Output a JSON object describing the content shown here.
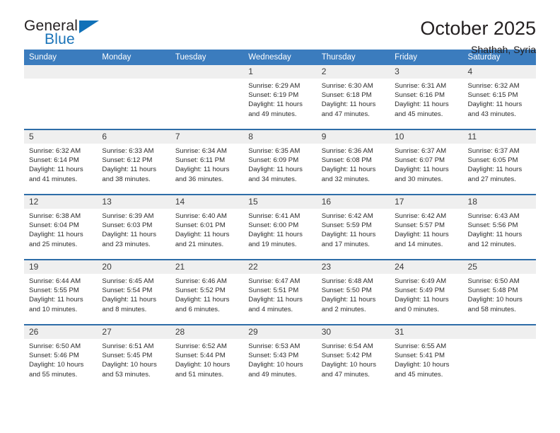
{
  "brand": {
    "word_one": "General",
    "word_two": "Blue",
    "accent_color": "#1171b8",
    "triangle_icon": "triangle-icon"
  },
  "header": {
    "title": "October 2025",
    "subtitle": "Shathah, Syria"
  },
  "theme": {
    "header_row_bg": "#3b7cbe",
    "cell_border": "#2e6da8",
    "daynum_bg": "#efefef"
  },
  "weekday_headers": [
    "Sunday",
    "Monday",
    "Tuesday",
    "Wednesday",
    "Thursday",
    "Friday",
    "Saturday"
  ],
  "labels": {
    "sunrise": "Sunrise:",
    "sunset": "Sunset:",
    "daylight": "Daylight:"
  },
  "calendar": {
    "weeks": [
      [
        {
          "day": "",
          "lines": []
        },
        {
          "day": "",
          "lines": []
        },
        {
          "day": "",
          "lines": []
        },
        {
          "day": "1",
          "lines": [
            "Sunrise: 6:29 AM",
            "Sunset: 6:19 PM",
            "Daylight: 11 hours",
            "and 49 minutes."
          ]
        },
        {
          "day": "2",
          "lines": [
            "Sunrise: 6:30 AM",
            "Sunset: 6:18 PM",
            "Daylight: 11 hours",
            "and 47 minutes."
          ]
        },
        {
          "day": "3",
          "lines": [
            "Sunrise: 6:31 AM",
            "Sunset: 6:16 PM",
            "Daylight: 11 hours",
            "and 45 minutes."
          ]
        },
        {
          "day": "4",
          "lines": [
            "Sunrise: 6:32 AM",
            "Sunset: 6:15 PM",
            "Daylight: 11 hours",
            "and 43 minutes."
          ]
        }
      ],
      [
        {
          "day": "5",
          "lines": [
            "Sunrise: 6:32 AM",
            "Sunset: 6:14 PM",
            "Daylight: 11 hours",
            "and 41 minutes."
          ]
        },
        {
          "day": "6",
          "lines": [
            "Sunrise: 6:33 AM",
            "Sunset: 6:12 PM",
            "Daylight: 11 hours",
            "and 38 minutes."
          ]
        },
        {
          "day": "7",
          "lines": [
            "Sunrise: 6:34 AM",
            "Sunset: 6:11 PM",
            "Daylight: 11 hours",
            "and 36 minutes."
          ]
        },
        {
          "day": "8",
          "lines": [
            "Sunrise: 6:35 AM",
            "Sunset: 6:09 PM",
            "Daylight: 11 hours",
            "and 34 minutes."
          ]
        },
        {
          "day": "9",
          "lines": [
            "Sunrise: 6:36 AM",
            "Sunset: 6:08 PM",
            "Daylight: 11 hours",
            "and 32 minutes."
          ]
        },
        {
          "day": "10",
          "lines": [
            "Sunrise: 6:37 AM",
            "Sunset: 6:07 PM",
            "Daylight: 11 hours",
            "and 30 minutes."
          ]
        },
        {
          "day": "11",
          "lines": [
            "Sunrise: 6:37 AM",
            "Sunset: 6:05 PM",
            "Daylight: 11 hours",
            "and 27 minutes."
          ]
        }
      ],
      [
        {
          "day": "12",
          "lines": [
            "Sunrise: 6:38 AM",
            "Sunset: 6:04 PM",
            "Daylight: 11 hours",
            "and 25 minutes."
          ]
        },
        {
          "day": "13",
          "lines": [
            "Sunrise: 6:39 AM",
            "Sunset: 6:03 PM",
            "Daylight: 11 hours",
            "and 23 minutes."
          ]
        },
        {
          "day": "14",
          "lines": [
            "Sunrise: 6:40 AM",
            "Sunset: 6:01 PM",
            "Daylight: 11 hours",
            "and 21 minutes."
          ]
        },
        {
          "day": "15",
          "lines": [
            "Sunrise: 6:41 AM",
            "Sunset: 6:00 PM",
            "Daylight: 11 hours",
            "and 19 minutes."
          ]
        },
        {
          "day": "16",
          "lines": [
            "Sunrise: 6:42 AM",
            "Sunset: 5:59 PM",
            "Daylight: 11 hours",
            "and 17 minutes."
          ]
        },
        {
          "day": "17",
          "lines": [
            "Sunrise: 6:42 AM",
            "Sunset: 5:57 PM",
            "Daylight: 11 hours",
            "and 14 minutes."
          ]
        },
        {
          "day": "18",
          "lines": [
            "Sunrise: 6:43 AM",
            "Sunset: 5:56 PM",
            "Daylight: 11 hours",
            "and 12 minutes."
          ]
        }
      ],
      [
        {
          "day": "19",
          "lines": [
            "Sunrise: 6:44 AM",
            "Sunset: 5:55 PM",
            "Daylight: 11 hours",
            "and 10 minutes."
          ]
        },
        {
          "day": "20",
          "lines": [
            "Sunrise: 6:45 AM",
            "Sunset: 5:54 PM",
            "Daylight: 11 hours",
            "and 8 minutes."
          ]
        },
        {
          "day": "21",
          "lines": [
            "Sunrise: 6:46 AM",
            "Sunset: 5:52 PM",
            "Daylight: 11 hours",
            "and 6 minutes."
          ]
        },
        {
          "day": "22",
          "lines": [
            "Sunrise: 6:47 AM",
            "Sunset: 5:51 PM",
            "Daylight: 11 hours",
            "and 4 minutes."
          ]
        },
        {
          "day": "23",
          "lines": [
            "Sunrise: 6:48 AM",
            "Sunset: 5:50 PM",
            "Daylight: 11 hours",
            "and 2 minutes."
          ]
        },
        {
          "day": "24",
          "lines": [
            "Sunrise: 6:49 AM",
            "Sunset: 5:49 PM",
            "Daylight: 11 hours",
            "and 0 minutes."
          ]
        },
        {
          "day": "25",
          "lines": [
            "Sunrise: 6:50 AM",
            "Sunset: 5:48 PM",
            "Daylight: 10 hours",
            "and 58 minutes."
          ]
        }
      ],
      [
        {
          "day": "26",
          "lines": [
            "Sunrise: 6:50 AM",
            "Sunset: 5:46 PM",
            "Daylight: 10 hours",
            "and 55 minutes."
          ]
        },
        {
          "day": "27",
          "lines": [
            "Sunrise: 6:51 AM",
            "Sunset: 5:45 PM",
            "Daylight: 10 hours",
            "and 53 minutes."
          ]
        },
        {
          "day": "28",
          "lines": [
            "Sunrise: 6:52 AM",
            "Sunset: 5:44 PM",
            "Daylight: 10 hours",
            "and 51 minutes."
          ]
        },
        {
          "day": "29",
          "lines": [
            "Sunrise: 6:53 AM",
            "Sunset: 5:43 PM",
            "Daylight: 10 hours",
            "and 49 minutes."
          ]
        },
        {
          "day": "30",
          "lines": [
            "Sunrise: 6:54 AM",
            "Sunset: 5:42 PM",
            "Daylight: 10 hours",
            "and 47 minutes."
          ]
        },
        {
          "day": "31",
          "lines": [
            "Sunrise: 6:55 AM",
            "Sunset: 5:41 PM",
            "Daylight: 10 hours",
            "and 45 minutes."
          ]
        },
        {
          "day": "",
          "lines": []
        }
      ]
    ]
  }
}
